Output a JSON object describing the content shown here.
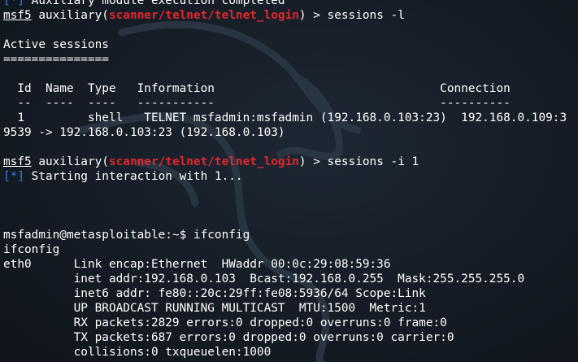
{
  "terminal": {
    "lines": [
      {
        "segments": [
          {
            "t": "[*]",
            "c": "blue"
          },
          {
            "t": " Auxiliary module execution completed"
          }
        ]
      },
      {
        "segments": [
          {
            "t": "msf5",
            "c": "u"
          },
          {
            "t": " auxiliary("
          },
          {
            "t": "scanner/telnet/telnet_login",
            "c": "red"
          },
          {
            "t": ") > sessions -l"
          }
        ]
      },
      {
        "segments": []
      },
      {
        "segments": [
          {
            "t": "Active sessions"
          }
        ]
      },
      {
        "segments": [
          {
            "t": "==============="
          }
        ]
      },
      {
        "segments": []
      },
      {
        "segments": [
          {
            "t": "  Id  Name  Type   Information                                Connection"
          }
        ]
      },
      {
        "segments": [
          {
            "t": "  --  ----  ----   -----------                                ----------"
          }
        ]
      },
      {
        "segments": [
          {
            "t": "  1         shell   TELNET msfadmin:msfadmin (192.168.0.103:23)  192.168.0.109:3"
          }
        ]
      },
      {
        "segments": [
          {
            "t": "9539 -> 192.168.0.103:23 (192.168.0.103)"
          }
        ]
      },
      {
        "segments": []
      },
      {
        "segments": [
          {
            "t": "msf5",
            "c": "u"
          },
          {
            "t": " auxiliary("
          },
          {
            "t": "scanner/telnet/telnet_login",
            "c": "red"
          },
          {
            "t": ") > sessions -i 1"
          }
        ]
      },
      {
        "segments": [
          {
            "t": "[*]",
            "c": "blue"
          },
          {
            "t": " Starting interaction with 1..."
          }
        ]
      },
      {
        "segments": []
      },
      {
        "segments": []
      },
      {
        "segments": []
      },
      {
        "segments": [
          {
            "t": "msfadmin@metasploitable:~$ ifconfig"
          }
        ]
      },
      {
        "segments": [
          {
            "t": "ifconfig"
          }
        ]
      },
      {
        "segments": [
          {
            "t": "eth0      Link encap:Ethernet  HWaddr 00:0c:29:08:59:36"
          }
        ]
      },
      {
        "segments": [
          {
            "t": "          inet addr:192.168.0.103  Bcast:192.168.0.255  Mask:255.255.255.0"
          }
        ]
      },
      {
        "segments": [
          {
            "t": "          inet6 addr: fe80::20c:29ff:fe08:5936/64 Scope:Link"
          }
        ]
      },
      {
        "segments": [
          {
            "t": "          UP BROADCAST RUNNING MULTICAST  MTU:1500  Metric:1"
          }
        ]
      },
      {
        "segments": [
          {
            "t": "          RX packets:2829 errors:0 dropped:0 overruns:0 frame:0"
          }
        ]
      },
      {
        "segments": [
          {
            "t": "          TX packets:687 errors:0 dropped:0 overruns:0 carrier:0"
          }
        ]
      },
      {
        "segments": [
          {
            "t": "          collisions:0 txqueuelen:1000"
          }
        ]
      }
    ]
  },
  "colors": {
    "background": "#151c25",
    "text": "#ffffff",
    "prompt_blue": "#3a78f2",
    "module_red": "#e3272d"
  },
  "background_graphic": "kali-dragon-watermark"
}
